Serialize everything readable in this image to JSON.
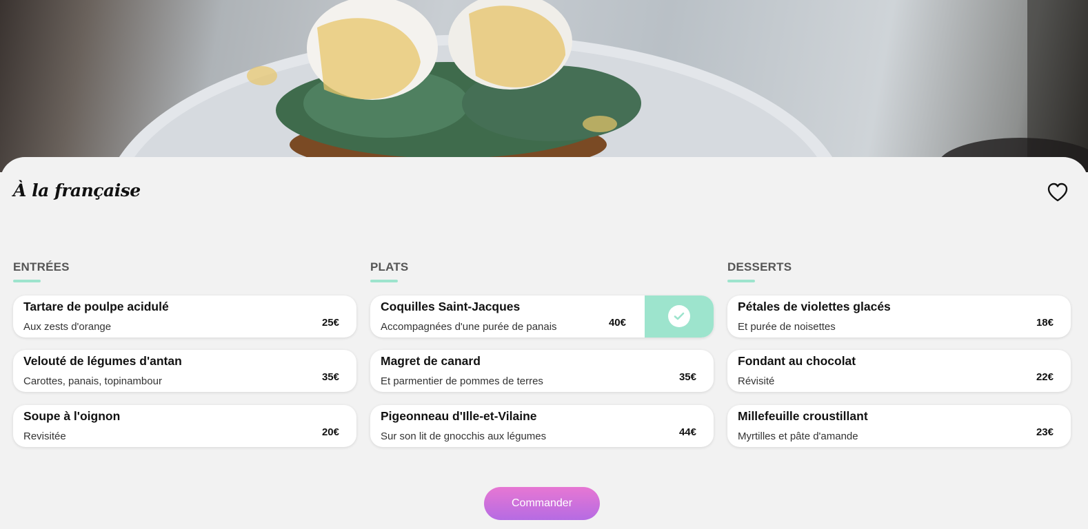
{
  "restaurant": {
    "title": "À la française"
  },
  "icons": {
    "favorite": "heart-outline-icon",
    "selected": "check-icon"
  },
  "colors": {
    "accent": "#9de4cd",
    "button_start": "#e777d3",
    "button_end": "#b56be3",
    "background": "#f2f2f2"
  },
  "menu": {
    "entrees": {
      "heading": "ENTRÉES",
      "items": [
        {
          "name": "Tartare de poulpe acidulé",
          "description": "Aux zests d'orange",
          "price": "25€"
        },
        {
          "name": "Velouté de légumes d'antan",
          "description": "Carottes, panais, topinambour",
          "price": "35€"
        },
        {
          "name": "Soupe à l'oignon",
          "description": "Revisitée",
          "price": "20€"
        }
      ]
    },
    "plats": {
      "heading": "PLATS",
      "items": [
        {
          "name": "Coquilles Saint-Jacques",
          "description": "Accompagnées d'une purée de panais",
          "price": "40€",
          "selected": true
        },
        {
          "name": "Magret de canard",
          "description": "Et parmentier de pommes de terres",
          "price": "35€"
        },
        {
          "name": "Pigeonneau d'Ille-et-Vilaine",
          "description": "Sur son lit de gnocchis aux légumes",
          "price": "44€"
        }
      ]
    },
    "desserts": {
      "heading": "DESSERTS",
      "items": [
        {
          "name": "Pétales de violettes glacés",
          "description": "Et purée de noisettes",
          "price": "18€"
        },
        {
          "name": "Fondant au chocolat",
          "description": "Révisité",
          "price": "22€"
        },
        {
          "name": "Millefeuille croustillant",
          "description": "Myrtilles et pâte d'amande",
          "price": "23€"
        }
      ]
    }
  },
  "order_button": {
    "label": "Commander"
  }
}
